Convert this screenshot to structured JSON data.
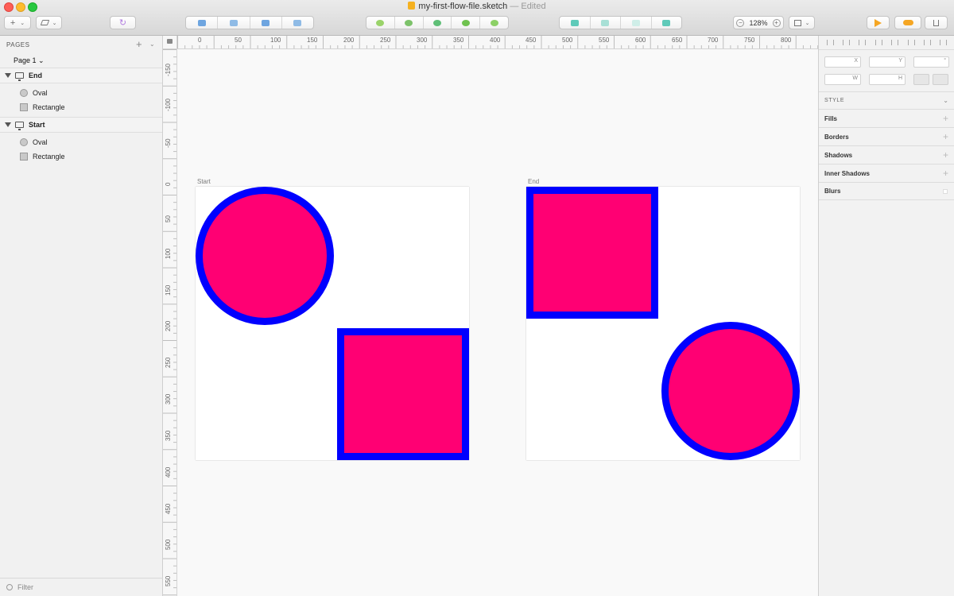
{
  "window": {
    "title": "my-first-flow-file.sketch",
    "status": "— Edited"
  },
  "toolbar": {
    "insert_glyph": "+",
    "zoom_level": "128%",
    "zoom_out": "−",
    "zoom_in": "+"
  },
  "sidebar": {
    "header": "PAGES",
    "add": "+",
    "page": "Page 1 ⌄",
    "groups": [
      {
        "label": "End",
        "layers": [
          {
            "label": "Oval",
            "icon": "oval-icon"
          },
          {
            "label": "Rectangle",
            "icon": "rectangle-icon"
          }
        ]
      },
      {
        "label": "Start",
        "layers": [
          {
            "label": "Oval",
            "icon": "oval-icon"
          },
          {
            "label": "Rectangle",
            "icon": "rectangle-icon"
          }
        ]
      }
    ],
    "filter": "Filter"
  },
  "ruler": {
    "h": [
      "0",
      "50",
      "100",
      "150",
      "200",
      "250",
      "300",
      "350",
      "400",
      "450",
      "500",
      "550",
      "600",
      "650",
      "700",
      "750",
      "800"
    ],
    "v": [
      "-150",
      "-100",
      "-50",
      "0",
      "50",
      "100",
      "150",
      "200",
      "250",
      "300",
      "350",
      "400",
      "450",
      "500",
      "550"
    ]
  },
  "canvas": {
    "artboards": [
      {
        "title": "Start"
      },
      {
        "title": "End"
      }
    ],
    "colors": {
      "fill": "#ff0073",
      "border": "#0000ff"
    }
  },
  "inspector": {
    "fields": {
      "x": "X",
      "y": "Y",
      "rotation": "°",
      "w": "W",
      "h": "H"
    },
    "style_header": "STYLE",
    "sections": [
      {
        "label": "Fills"
      },
      {
        "label": "Borders"
      },
      {
        "label": "Shadows"
      },
      {
        "label": "Inner Shadows"
      },
      {
        "label": "Blurs"
      }
    ]
  }
}
